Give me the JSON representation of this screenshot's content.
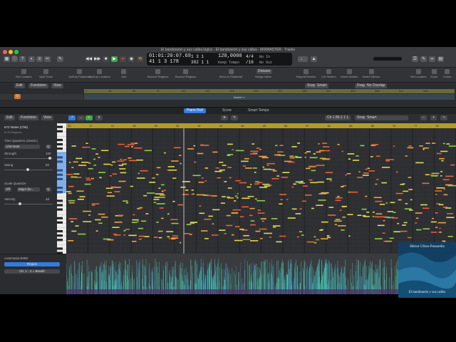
{
  "window": {
    "title": "El bandoneón y sus calles.logicx - El bandoneón y sus calles - MIXMASTER - Tracks"
  },
  "transport": {
    "time": "01:01:20:07.69",
    "bars": "41  1  3  178",
    "beat_top": "1  3  1",
    "beat_bottom": "302  1  1",
    "tempo": "120,0000",
    "tempo_label": "Keep Tempo",
    "signature": "4/4",
    "division": "/16",
    "in_label": "No In",
    "out_label": "No Out"
  },
  "toolbar": {
    "items": [
      "Set Locators",
      "Split Track",
      "Split by Playhead",
      "Split by Locators",
      "Join",
      "Bounce Regions",
      "Move to Playhead",
      "Nudge Value",
      "Repeat Section",
      "Cut Section",
      "Insert Section",
      "Insert Silence",
      "Set Locators",
      "Zoom",
      "Colors"
    ],
    "division": "Division",
    "snap_label": "Snap:",
    "snap_value": "Smart",
    "drag_label": "Drag:",
    "drag_value": "No Overlap"
  },
  "tracks": {
    "edit": "Edit",
    "functions": "Functions",
    "view": "View",
    "ruler": [
      "1",
      "33",
      "65",
      "97",
      "129",
      "161",
      "193",
      "225",
      "257",
      "289",
      "321",
      "353",
      "385",
      "417",
      "449"
    ],
    "region_name": "Master 1"
  },
  "piano_roll": {
    "tabs": [
      "Piano Roll",
      "Score",
      "Smart Tempo"
    ],
    "active_tab": "Piano Roll",
    "edit": "Edit",
    "functions": "Functions",
    "view": "View",
    "channel": "Ch 1   86 2 1 1",
    "snap_label": "Snap:",
    "snap_value": "Smart",
    "ruler": [
      "13",
      "17",
      "21",
      "25",
      "29",
      "33",
      "37",
      "41",
      "45",
      "49",
      "53",
      "57",
      "61",
      "65",
      "69",
      "73",
      "77",
      "81"
    ]
  },
  "inspector": {
    "notes": "672 Notes (Ch6)",
    "regions": "in 20 Regions",
    "time_quantize": "Time Quantize (classic)",
    "quantize_value": "1/16 Note",
    "strength_label": "Strength",
    "strength_value": "100",
    "swing_label": "Swing",
    "swing_value": "50",
    "scale_quantize": "Scale Quantize",
    "scale_off": "Off",
    "scale_value": "Major (lo...",
    "velocity_label": "Velocity",
    "velocity_value": "48"
  },
  "automation": {
    "label": "Automation/MIDI",
    "region": "Region",
    "param": "Ch. 1 - 2 = Breath"
  },
  "album_art": {
    "artist": "Héctor Ulises Passarella",
    "title": "El bandoneón y sus calles"
  },
  "colors": {
    "accent": "#2f7de1",
    "ruler": "#b39a2b",
    "region": "#39484f",
    "velocity": "#49d3b6"
  }
}
